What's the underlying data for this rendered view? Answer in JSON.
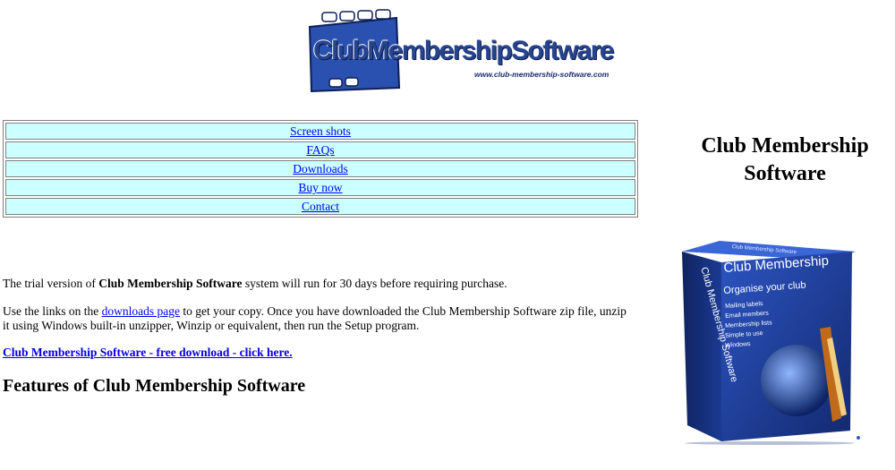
{
  "logo": {
    "text": "ClubMembershipSoftware",
    "url_text": "www.club-membership-software.com"
  },
  "nav": {
    "items": [
      {
        "label": "Screen shots"
      },
      {
        "label": "FAQs"
      },
      {
        "label": "Downloads"
      },
      {
        "label": "Buy now"
      },
      {
        "label": "Contact"
      }
    ]
  },
  "side": {
    "title": "Club Membership Software",
    "box": {
      "front_title": "Club Membership",
      "tagline": "Organise your club",
      "features": [
        "Mailing labels",
        "Email members",
        "Membership lists",
        "Simple to use",
        "Windows"
      ],
      "spine_text": "Club Membership Software",
      "top_text": "Club Membership Software"
    }
  },
  "content": {
    "intro_pre": "The trial version of ",
    "intro_bold": "Club Membership Software",
    "intro_post": " system will run for 30 days before requiring purchase.",
    "links_pre": "Use the links on the ",
    "links_link": "downloads page",
    "links_post": " to get your copy. Once you have downloaded the Club Membership Software zip file, unzip it using Windows built-in unzipper, Winzip or equivalent, then run the Setup program.",
    "download_link": "Club Membership Software - free download - click here.",
    "features_heading": "Features of Club Membership Software"
  },
  "colors": {
    "link": "#0000ee",
    "nav_cell_bg": "#ccffff",
    "logo_blue": "#27448e",
    "box_blue": "#1f3f9c"
  }
}
